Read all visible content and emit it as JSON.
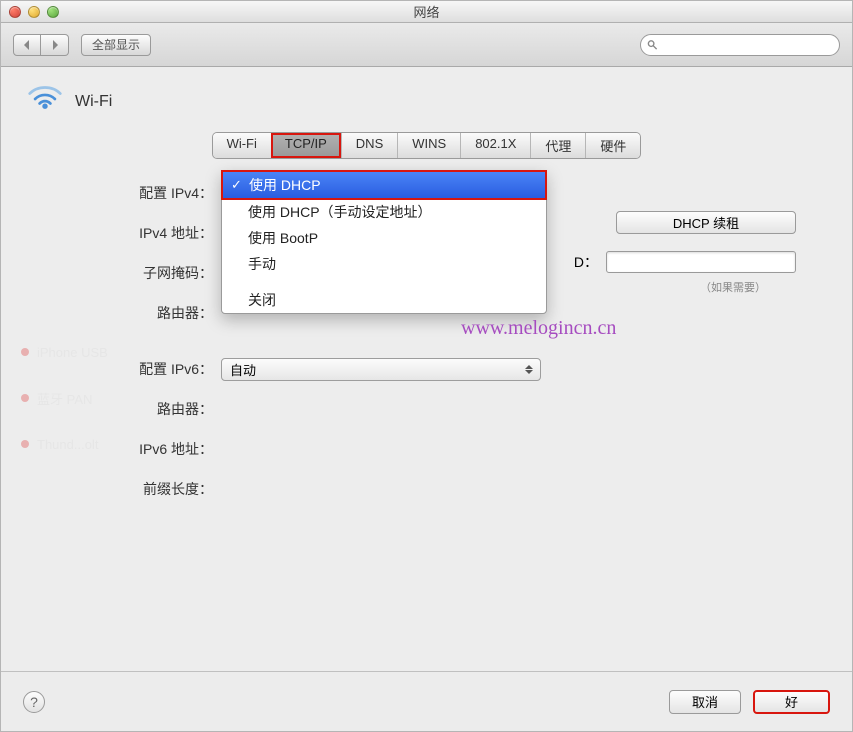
{
  "window": {
    "title": "网络"
  },
  "toolbar": {
    "showAll": "全部显示"
  },
  "header": {
    "name": "Wi-Fi"
  },
  "tabs": {
    "wifi": "Wi-Fi",
    "tcpip": "TCP/IP",
    "dns": "DNS",
    "wins": "WINS",
    "dot1x": "802.1X",
    "proxy": "代理",
    "hardware": "硬件"
  },
  "labels": {
    "configureIPv4": "配置 IPv4：",
    "ipv4Address": "IPv4 地址：",
    "subnetMask": "子网掩码：",
    "router4": "路由器：",
    "configureIPv6": "配置 IPv6：",
    "router6": "路由器：",
    "ipv6Address": "IPv6 地址：",
    "prefixLength": "前缀长度："
  },
  "ipv4Menu": {
    "useDHCP": "使用 DHCP",
    "useDHCPManual": "使用 DHCP（手动设定地址）",
    "useBootP": "使用 BootP",
    "manual": "手动",
    "off": "关闭"
  },
  "ipv6Select": {
    "value": "自动"
  },
  "dhcp": {
    "renew": "DHCP 续租",
    "clientIdSuffix": "D：",
    "hint": "（如果需要）"
  },
  "buttons": {
    "cancel": "取消",
    "ok": "好"
  },
  "watermark": "www.melogincn.cn"
}
